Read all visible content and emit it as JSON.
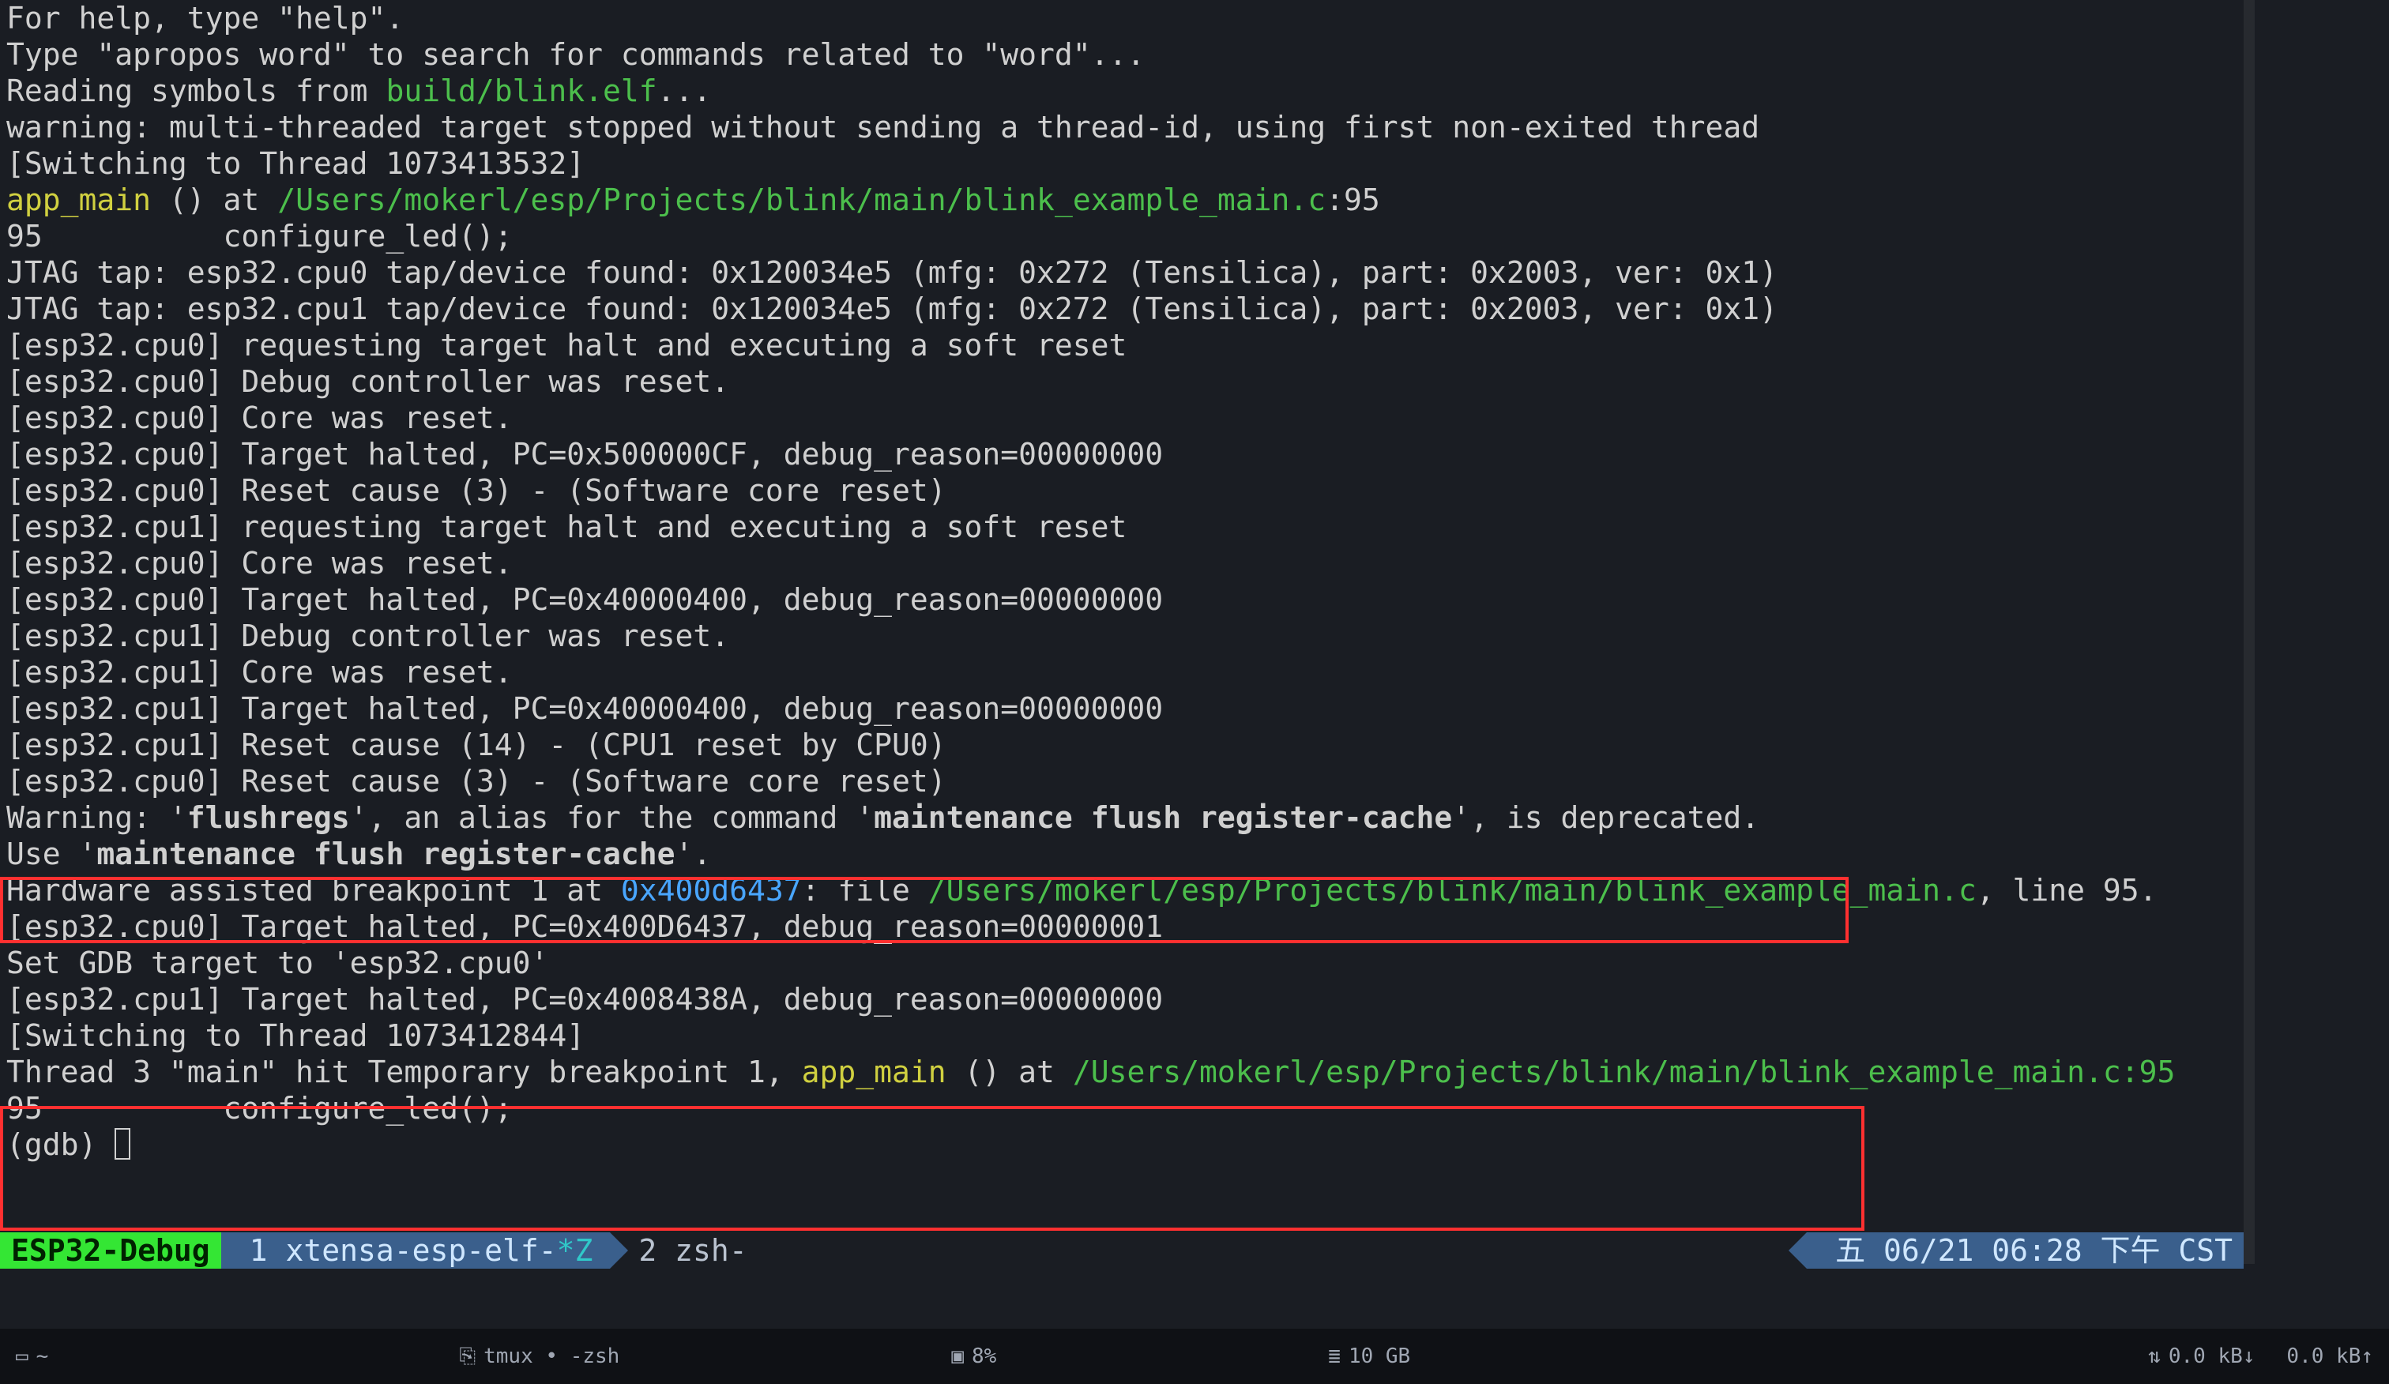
{
  "gdb": {
    "help1": "For help, type \"help\".",
    "help2": "Type \"apropos word\" to search for commands related to \"word\"...",
    "read_sym_prefix": "Reading symbols from ",
    "read_sym_path": "build/blink.elf",
    "read_sym_suffix": "...",
    "warn_thread": "warning: multi-threaded target stopped without sending a thread-id, using first non-exited thread",
    "switch1": "[Switching to Thread 1073413532]",
    "app_main_fn": "app_main",
    "app_main_paren": " () at ",
    "app_main_path": "/Users/mokerl/esp/Projects/blink/main/blink_example_main.c",
    "app_main_line": ":95",
    "src_line1": "95          configure_led();",
    "jtag0": "JTAG tap: esp32.cpu0 tap/device found: 0x120034e5 (mfg: 0x272 (Tensilica), part: 0x2003, ver: 0x1)",
    "jtag1": "JTAG tap: esp32.cpu1 tap/device found: 0x120034e5 (mfg: 0x272 (Tensilica), part: 0x2003, ver: 0x1)",
    "l01": "[esp32.cpu0] requesting target halt and executing a soft reset",
    "l02": "[esp32.cpu0] Debug controller was reset.",
    "l03": "[esp32.cpu0] Core was reset.",
    "l04": "[esp32.cpu0] Target halted, PC=0x500000CF, debug_reason=00000000",
    "l05": "[esp32.cpu0] Reset cause (3) - (Software core reset)",
    "l06": "[esp32.cpu1] requesting target halt and executing a soft reset",
    "l07": "[esp32.cpu0] Core was reset.",
    "l08": "[esp32.cpu0] Target halted, PC=0x40000400, debug_reason=00000000",
    "l09": "[esp32.cpu1] Debug controller was reset.",
    "l10": "[esp32.cpu1] Core was reset.",
    "l11": "[esp32.cpu1] Target halted, PC=0x40000400, debug_reason=00000000",
    "l12": "[esp32.cpu1] Reset cause (14) - (CPU1 reset by CPU0)",
    "l13": "[esp32.cpu0] Reset cause (3) - (Software core reset)",
    "warn_flush_pre": "Warning: '",
    "warn_flush_b1": "flushregs",
    "warn_flush_mid": "', an alias for the command '",
    "warn_flush_b2": "maintenance flush register-cache",
    "warn_flush_post": "', is deprecated.",
    "use_pre": "Use '",
    "use_b": "maintenance flush register-cache",
    "use_post": "'.",
    "blank": "",
    "hw_bp_pre": "Hardware assisted breakpoint 1 at ",
    "hw_bp_addr": "0x400d6437",
    "hw_bp_mid": ": file ",
    "hw_bp_path": "/Users/mokerl/esp/Projects/blink/main/blink_example_main.c",
    "hw_bp_post": ", line 95.",
    "l20": "[esp32.cpu0] Target halted, PC=0x400D6437, debug_reason=00000001",
    "l21": "Set GDB target to 'esp32.cpu0'",
    "l22": "[esp32.cpu1] Target halted, PC=0x4008438A, debug_reason=00000000",
    "switch2": "[Switching to Thread 1073412844]",
    "thread_hit_pre": "Thread 3 \"main\" hit Temporary breakpoint 1, ",
    "thread_hit_fn": "app_main",
    "thread_hit_mid": " () at ",
    "thread_hit_path": "/Users/mokerl/esp/Projects/blink/main/blink_example_main.c:95",
    "src_line2": "95          configure_led();",
    "prompt": "(gdb) "
  },
  "tmux": {
    "session": "ESP32-Debug",
    "win1_idx": "1",
    "win1_name": "xtensa-esp-elf-",
    "win1_flag": "*Z",
    "win2_idx": "2",
    "win2_name": "zsh",
    "win2_flag": "-",
    "clock": "五 06/21 06:28 下午 CST"
  },
  "osbar": {
    "left_icon": "▭",
    "left_text": "~",
    "tmux_icon": "⎘",
    "tmux_text": "tmux • -zsh",
    "cpu_icon": "▣",
    "cpu_text": "8%",
    "mem_icon": "≣",
    "mem_text": "10 GB",
    "net_down_icon": "⇅",
    "net_down": "0.0 kB↓",
    "net_up": "0.0 kB↑"
  }
}
